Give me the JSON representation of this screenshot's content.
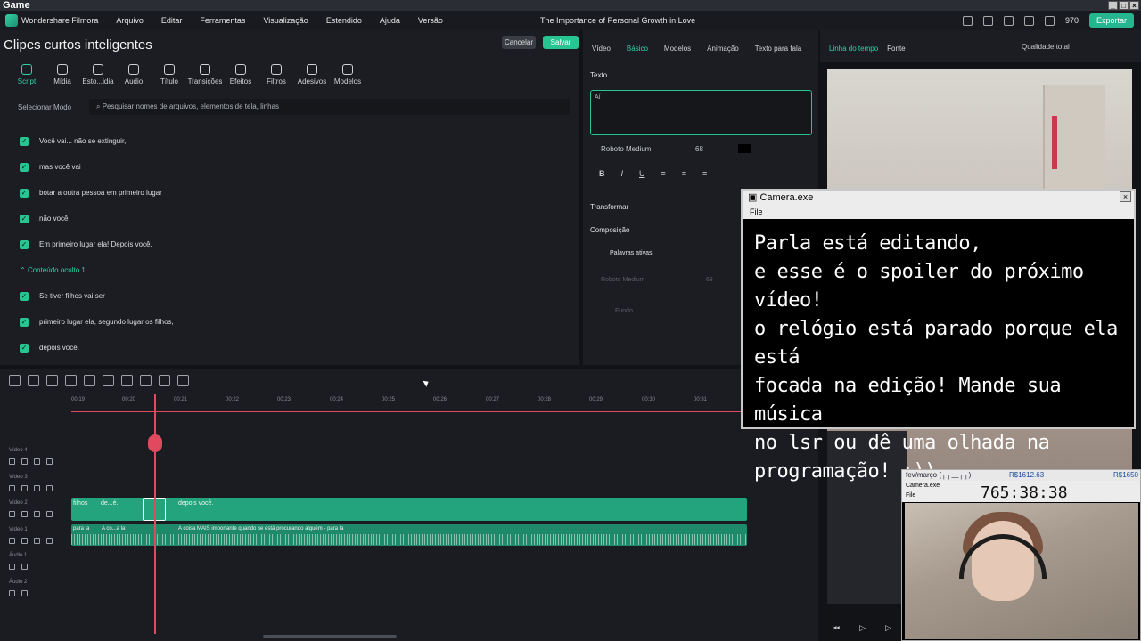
{
  "os_window": {
    "title": "Game"
  },
  "menubar": {
    "app_name": "Wondershare Filmora",
    "items": [
      "Arquivo",
      "Editar",
      "Ferramentas",
      "Visualização",
      "Estendido",
      "Ajuda",
      "Versão"
    ],
    "project_title": "The Importance of Personal Growth in Love",
    "credits": "970",
    "export_label": "Exportar"
  },
  "editor": {
    "title": "Clipes curtos inteligentes",
    "cancel_label": "Cancelar",
    "save_label": "Salvar",
    "tools": [
      {
        "label": "Script",
        "icon": "script-icon",
        "active": true
      },
      {
        "label": "Mídia",
        "icon": "media-icon"
      },
      {
        "label": "Esto...idia",
        "icon": "stock-media-icon"
      },
      {
        "label": "Áudio",
        "icon": "audio-icon"
      },
      {
        "label": "Título",
        "icon": "title-icon"
      },
      {
        "label": "Transições",
        "icon": "transitions-icon"
      },
      {
        "label": "Efeitos",
        "icon": "effects-icon"
      },
      {
        "label": "Filtros",
        "icon": "filters-icon"
      },
      {
        "label": "Adesivos",
        "icon": "stickers-icon"
      },
      {
        "label": "Modelos",
        "icon": "templates-icon"
      }
    ],
    "mode_select": "Selecionar Modo",
    "search_placeholder": "Pesquisar nomes de arquivos, elementos de tela, linhas",
    "script_items": [
      "Você vai... não se extinguir,",
      "mas você vai",
      "botar a outra pessoa em primeiro lugar",
      "não você",
      "Em primeiro lugar ela! Depois você."
    ],
    "hidden_header": "Conteúdo oculto 1",
    "hidden_items": [
      "Se tiver filhos vai ser",
      "primeiro lugar ela, segundo lugar os filhos,",
      "depois você."
    ]
  },
  "properties": {
    "tabs": [
      "Vídeo",
      "Básico",
      "Modelos",
      "Animação",
      "Texto para fala"
    ],
    "active_tab": "Básico",
    "text_section": "Texto",
    "text_value": "Aí",
    "font": "Roboto Medium",
    "font_size": "68",
    "format_buttons": [
      "B",
      "I",
      "U"
    ],
    "transform_label": "Transformar",
    "composition_label": "Composição",
    "active_words_label": "Palavras ativas",
    "font2": "Roboto Medium",
    "font_size2": "68",
    "background_label": "Fundo"
  },
  "preview": {
    "tabs": [
      "Linha do tempo",
      "Fonte"
    ],
    "quality": "Qualidade total"
  },
  "timeline": {
    "ruler_labels": [
      "00:19",
      "00:20",
      "00:21",
      "00:22",
      "00:23",
      "00:24",
      "00:25",
      "00:26",
      "00:27",
      "00:28",
      "00:29",
      "00:30",
      "00:31"
    ],
    "tracks": [
      "Vídeo 4",
      "Vídeo 3",
      "Vídeo 2",
      "Vídeo 1",
      "Áudio 1",
      "Áudio 2"
    ],
    "clips_v2": [
      "filhos",
      "de...é.",
      "depois você."
    ],
    "clips_v1": [
      "para la",
      "A co...a la",
      "A coisa MAIS importante quando se está procurando alguém - para la"
    ]
  },
  "camera_window": {
    "title": "Camera.exe",
    "menu": "File",
    "message": "Parla está editando,\ne esse é o spoiler do próximo vídeo!\no relógio está parado porque ela está\nfocada na edição! Mande sua música\nno lsr ou dê uma olhada na\nprogramação! :))"
  },
  "mini_window": {
    "period": "fev/março (┬┬﹏┬┬)",
    "value1": "R$1612.63",
    "value2": "R$1650",
    "title": "Camera.exe",
    "menu": "File",
    "clock": "765:38:38"
  }
}
